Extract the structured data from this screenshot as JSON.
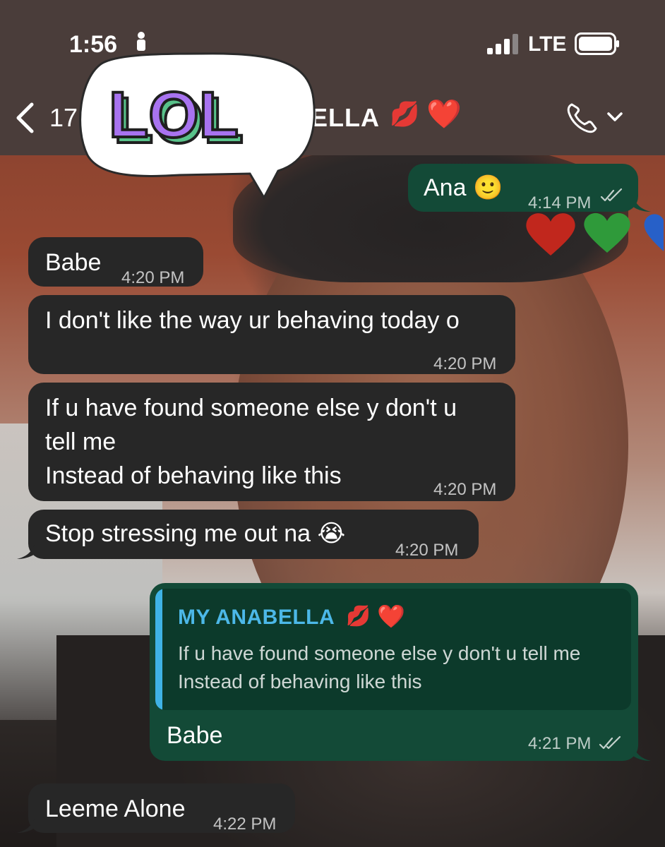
{
  "status_bar": {
    "time": "1:56",
    "network": "LTE"
  },
  "header": {
    "back_icon": "chevron-left-icon",
    "contact_name_visible_start": "17",
    "contact_name_visible_end": "ELLA",
    "contact_emojis": [
      "💋",
      "❤️"
    ],
    "call_icon": "phone-icon",
    "sticker_text": "LOL"
  },
  "messages": [
    {
      "direction": "outgoing",
      "text": "Ana 🙂",
      "time": "4:14 PM",
      "read": true
    },
    {
      "direction": "incoming",
      "text": "Babe",
      "time": "4:20 PM"
    },
    {
      "direction": "incoming",
      "text": "I don't like the way ur behaving today o",
      "time": "4:20 PM"
    },
    {
      "direction": "incoming",
      "text": "If u have found someone else y don't u\ntell me\nInstead of behaving like this",
      "time": "4:20 PM"
    },
    {
      "direction": "incoming",
      "text": "Stop stressing me out na 😭",
      "time": "4:20 PM"
    },
    {
      "direction": "outgoing",
      "reply_to": {
        "name": "MY ANABELLA",
        "name_emojis": [
          "💋",
          "❤️"
        ],
        "text": "If u have found someone else y don't u tell me\nInstead of behaving like this"
      },
      "text": "Babe",
      "time": "4:21 PM",
      "read": true
    },
    {
      "direction": "incoming",
      "text": "Leeme Alone",
      "time": "4:22 PM"
    }
  ],
  "colors": {
    "incoming_bubble": "#272727",
    "outgoing_bubble": "#134a37",
    "quote_name": "#4cb8e8",
    "quote_bar": "#3fb3e6"
  }
}
